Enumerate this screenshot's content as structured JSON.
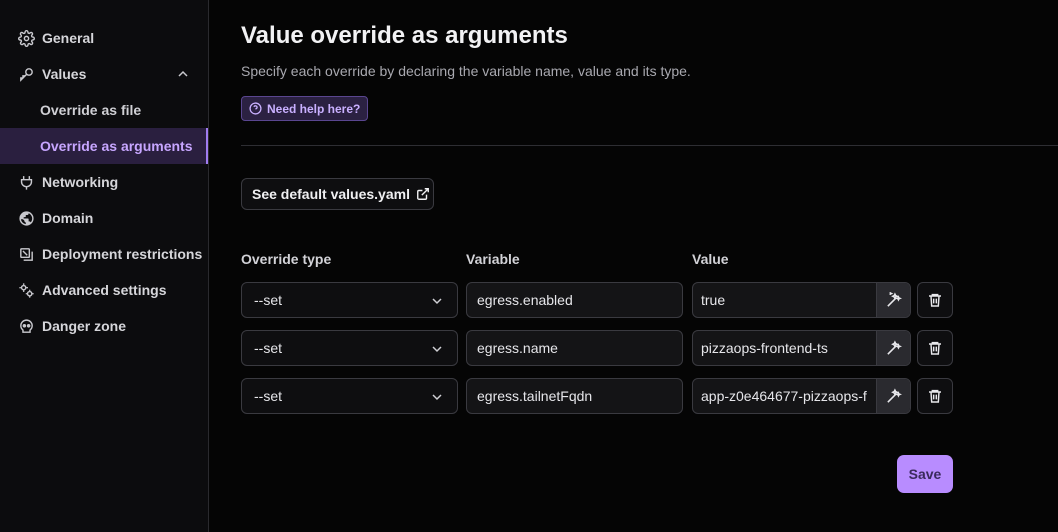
{
  "sidebar": {
    "items": [
      {
        "label": "General",
        "icon": "gear-icon"
      },
      {
        "label": "Values",
        "icon": "key-icon",
        "expanded": true,
        "children": [
          {
            "label": "Override as file",
            "active": false
          },
          {
            "label": "Override as arguments",
            "active": true
          }
        ]
      },
      {
        "label": "Networking",
        "icon": "plug-icon"
      },
      {
        "label": "Domain",
        "icon": "globe-icon"
      },
      {
        "label": "Deployment restrictions",
        "icon": "restriction-icon"
      },
      {
        "label": "Advanced settings",
        "icon": "cogs-icon"
      },
      {
        "label": "Danger zone",
        "icon": "skull-icon"
      }
    ]
  },
  "main": {
    "title": "Value override as arguments",
    "subtitle": "Specify each override by declaring the variable name, value and its type.",
    "help_label": "Need help here?",
    "default_values_label": "See default values.yaml",
    "columns": {
      "override_type": "Override type",
      "variable": "Variable",
      "value": "Value"
    },
    "rows": [
      {
        "type": "--set",
        "variable": "egress.enabled",
        "value": "true"
      },
      {
        "type": "--set",
        "variable": "egress.name",
        "value": "pizzaops-frontend-ts"
      },
      {
        "type": "--set",
        "variable": "egress.tailnetFqdn",
        "value": "app-z0e464677-pizzaops-f"
      }
    ],
    "save_label": "Save"
  },
  "colors": {
    "accent": "#b88cff",
    "active_bg": "#2a1f3f",
    "background": "#050505"
  }
}
